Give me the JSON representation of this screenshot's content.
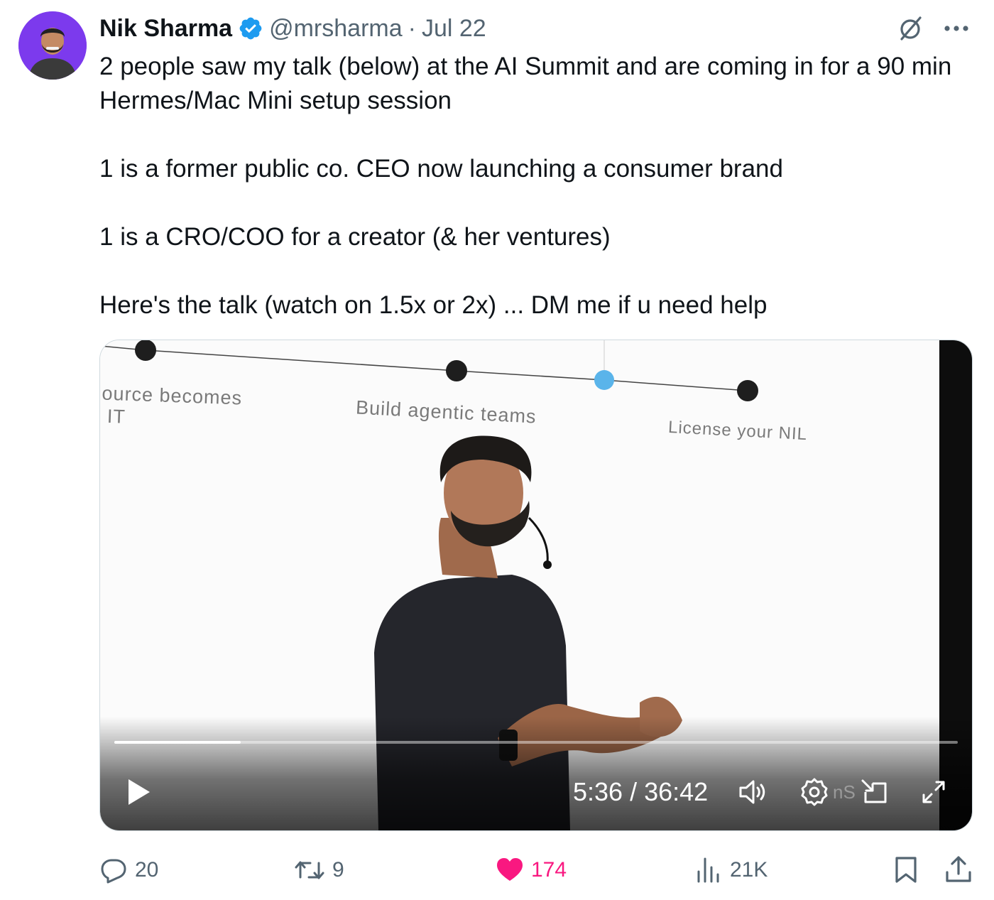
{
  "tweet": {
    "author_name": "Nik Sharma",
    "handle": "@mrsharma",
    "separator": "·",
    "date": "Jul 22",
    "text": "2 people saw my talk (below) at the AI Summit and are coming in for a 90 min Hermes/Mac Mini setup session\n\n1 is a former public co. CEO now launching a consumer brand\n\n1 is a CRO/COO for a creator (& her ventures)\n\nHere's the talk (watch on 1.5x or 2x) ... DM me if u need help"
  },
  "video": {
    "slide_labels": [
      "ource becomes\n IT",
      "Build agentic teams",
      "License your NIL"
    ],
    "current_time": "5:36",
    "duration": "36:42",
    "time_display": "5:36 / 36:42",
    "progress_fraction": 0.15,
    "overlay_text": "nS"
  },
  "actions": {
    "replies": "20",
    "reposts": "9",
    "likes": "174",
    "views": "21K"
  },
  "colors": {
    "verified_blue": "#1d9bf0",
    "like_pink": "#f91880",
    "muted_text": "#536471",
    "avatar_bg": "#7c3aed",
    "timeline_active": "#5ab4ea"
  },
  "icons": [
    "verified-badge-icon",
    "grok-icon",
    "more-icon",
    "play-icon",
    "volume-icon",
    "settings-icon",
    "pip-icon",
    "fullscreen-icon",
    "reply-icon",
    "repost-icon",
    "like-icon",
    "views-icon",
    "bookmark-icon",
    "share-icon"
  ]
}
